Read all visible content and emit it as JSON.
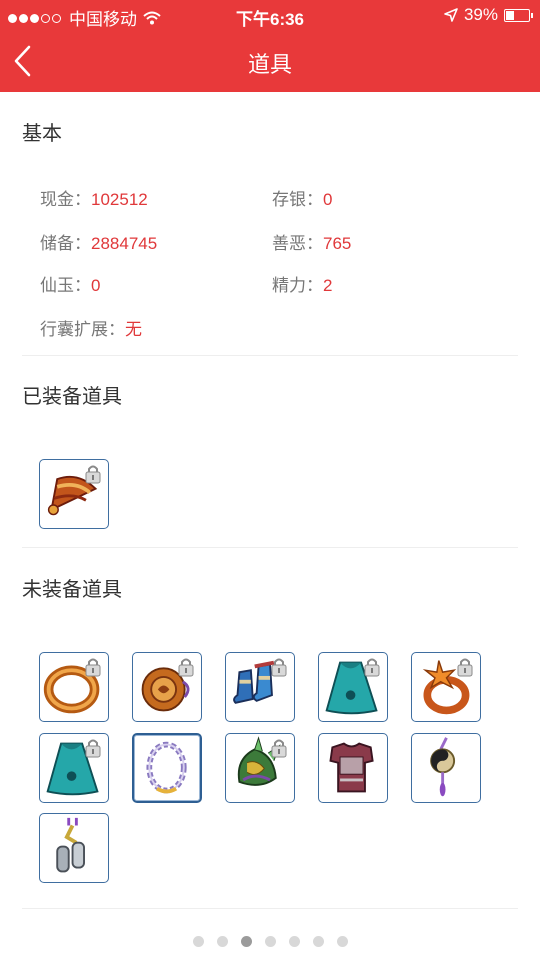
{
  "status_bar": {
    "carrier": "中国移动",
    "time": "下午6:36",
    "battery_text": "39%",
    "battery_level": 0.39
  },
  "nav": {
    "title": "道具"
  },
  "basic": {
    "heading": "基本",
    "fields": [
      {
        "label": "现金：",
        "value": "102512"
      },
      {
        "label": "存银：",
        "value": "0"
      },
      {
        "label": "储备：",
        "value": "2884745"
      },
      {
        "label": "善恶：",
        "value": "765"
      },
      {
        "label": "仙玉：",
        "value": "0"
      },
      {
        "label": "精力：",
        "value": "2"
      },
      {
        "label": "行囊扩展：",
        "value": "无"
      }
    ]
  },
  "equipped": {
    "heading": "已装备道具",
    "items": [
      {
        "icon": "fan-icon",
        "locked": true
      }
    ]
  },
  "unequipped": {
    "heading": "未装备道具",
    "items": [
      {
        "icon": "ring-icon",
        "locked": true
      },
      {
        "icon": "amulet-icon",
        "locked": true
      },
      {
        "icon": "boots-icon",
        "locked": true
      },
      {
        "icon": "cape-icon",
        "locked": true
      },
      {
        "icon": "flower-ring-icon",
        "locked": true
      },
      {
        "icon": "cape-icon",
        "locked": true
      },
      {
        "icon": "bead-necklace-icon",
        "locked": false,
        "selected": true
      },
      {
        "icon": "dragon-helmet-icon",
        "locked": true
      },
      {
        "icon": "armor-icon",
        "locked": false
      },
      {
        "icon": "yinyang-pendant-icon",
        "locked": false
      },
      {
        "icon": "chain-weight-icon",
        "locked": false
      }
    ]
  },
  "pager": {
    "count": 7,
    "active_index": 2
  },
  "colors": {
    "brand_red": "#e8393a",
    "value_red": "#e0383a",
    "slot_border": "#3f6ea0"
  }
}
